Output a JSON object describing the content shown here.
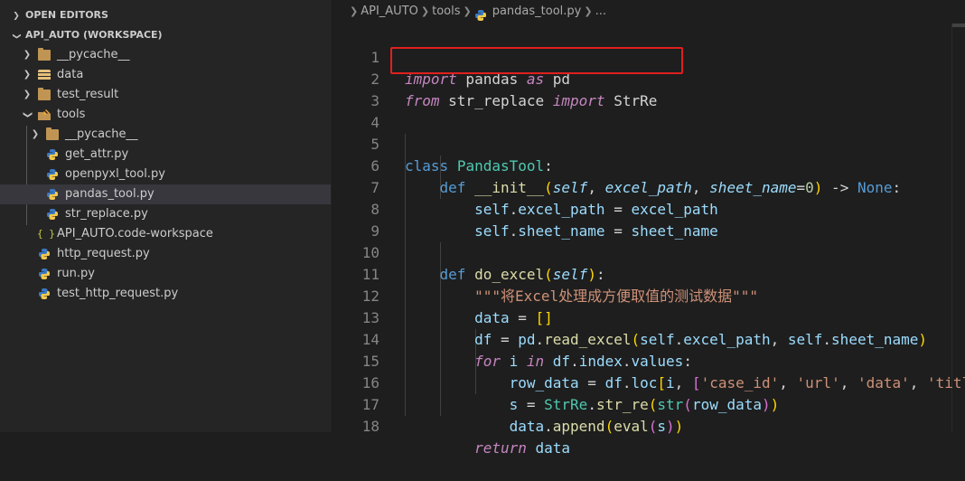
{
  "explorer": {
    "open_editors_label": "OPEN EDITORS",
    "workspace_label": "API_AUTO (WORKSPACE)",
    "items": [
      {
        "label": "__pycache__",
        "kind": "folder"
      },
      {
        "label": "data",
        "kind": "database-folder"
      },
      {
        "label": "test_result",
        "kind": "folder"
      },
      {
        "label": "tools",
        "kind": "tools-folder"
      },
      {
        "label": "__pycache__",
        "kind": "folder"
      },
      {
        "label": "get_attr.py",
        "kind": "python-file"
      },
      {
        "label": "openpyxl_tool.py",
        "kind": "python-file"
      },
      {
        "label": "pandas_tool.py",
        "kind": "python-file",
        "selected": true
      },
      {
        "label": "str_replace.py",
        "kind": "python-file"
      },
      {
        "label": "API_AUTO.code-workspace",
        "kind": "workspace-file"
      },
      {
        "label": "http_request.py",
        "kind": "python-file"
      },
      {
        "label": "run.py",
        "kind": "python-file"
      },
      {
        "label": "test_http_request.py",
        "kind": "python-file"
      }
    ]
  },
  "breadcrumb": {
    "root": "API_AUTO",
    "folder": "tools",
    "file": "pandas_tool.py",
    "more": "..."
  },
  "editor": {
    "line_numbers": [
      "1",
      "2",
      "3",
      "4",
      "5",
      "6",
      "7",
      "8",
      "9",
      "10",
      "11",
      "12",
      "13",
      "14",
      "15",
      "16",
      "17",
      "18"
    ],
    "highlighted_line": "2",
    "colors": {
      "highlight_box": "#e0201e",
      "keyword": "#569cd6",
      "control_keyword": "#c586c0",
      "function": "#dcdcaa",
      "class": "#4ec9b0",
      "variable": "#9cdcfe",
      "string": "#ce9178",
      "number": "#b5cea8"
    }
  }
}
